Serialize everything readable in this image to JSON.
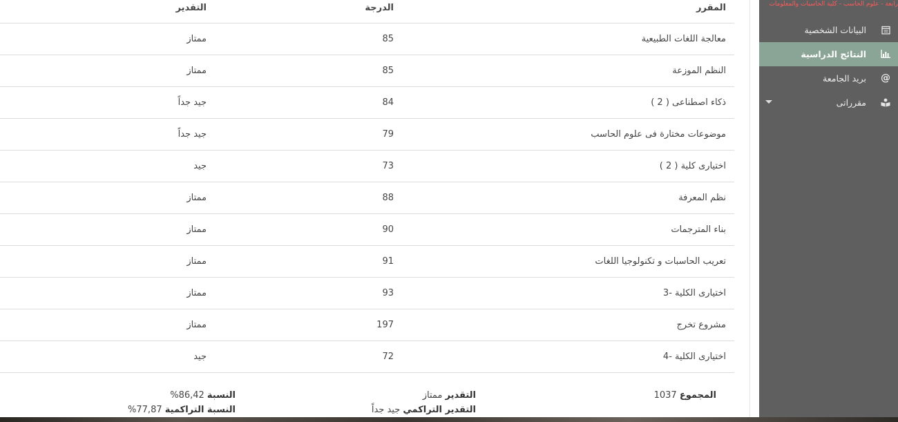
{
  "table": {
    "headers": {
      "course": "المقرر",
      "degree": "الدرجة",
      "grade": "التقدير"
    },
    "rows": [
      {
        "course": "معالجة اللغات الطبيعية",
        "degree": "85",
        "grade": "ممتاز"
      },
      {
        "course": "النظم الموزعة",
        "degree": "85",
        "grade": "ممتاز"
      },
      {
        "course": "ذكاء اصطناعى ( 2 )",
        "degree": "84",
        "grade": "جيد جداً"
      },
      {
        "course": "موضوعات مختارة فى علوم الحاسب",
        "degree": "79",
        "grade": "جيد جداً"
      },
      {
        "course": "اختيارى كلية ( 2 )",
        "degree": "73",
        "grade": "جيد"
      },
      {
        "course": "نظم المعرفة",
        "degree": "88",
        "grade": "ممتاز"
      },
      {
        "course": "بناء المترجمات",
        "degree": "90",
        "grade": "ممتاز"
      },
      {
        "course": "تعريب الحاسبات و تكنولوجيا اللغات",
        "degree": "91",
        "grade": "ممتاز"
      },
      {
        "course": "اختيارى الكلية -3",
        "degree": "93",
        "grade": "ممتاز"
      },
      {
        "course": "مشروع تخرج",
        "degree": "197",
        "grade": "ممتاز"
      },
      {
        "course": "اختيارى الكلية -4",
        "degree": "72",
        "grade": "جيد"
      }
    ]
  },
  "summary": {
    "total_label": "المجموع",
    "total_value": "1037",
    "grade_label": "التقدير",
    "grade_value": "ممتاز",
    "cumulative_grade_label": "التقدير التراكمي",
    "cumulative_grade_value": "جيد جداً",
    "percent_label": "النسبة",
    "percent_value": "86,42%",
    "cumulative_percent_label": "النسبة التراكمية",
    "cumulative_percent_value": "77,87%"
  },
  "sidebar": {
    "brand": "رابعة - علوم الحاسب - كلية الحاسبات والمعلومات",
    "items": [
      {
        "label": "البيانات الشخصية",
        "icon": "calendar-icon",
        "active": false
      },
      {
        "label": "النتائج الدراسية",
        "icon": "bar-chart-icon",
        "active": true
      },
      {
        "label": "بريد الجامعة",
        "icon": "at-sign-icon",
        "active": false
      },
      {
        "label": "مقرراتى",
        "icon": "book-reader-icon",
        "active": false
      }
    ]
  },
  "colors": {
    "sidebar_bg": "#5f5f5f",
    "active_item_bg": "#8aa496",
    "brand_text": "#ff5a5a",
    "row_divider": "#dcdcdc"
  }
}
